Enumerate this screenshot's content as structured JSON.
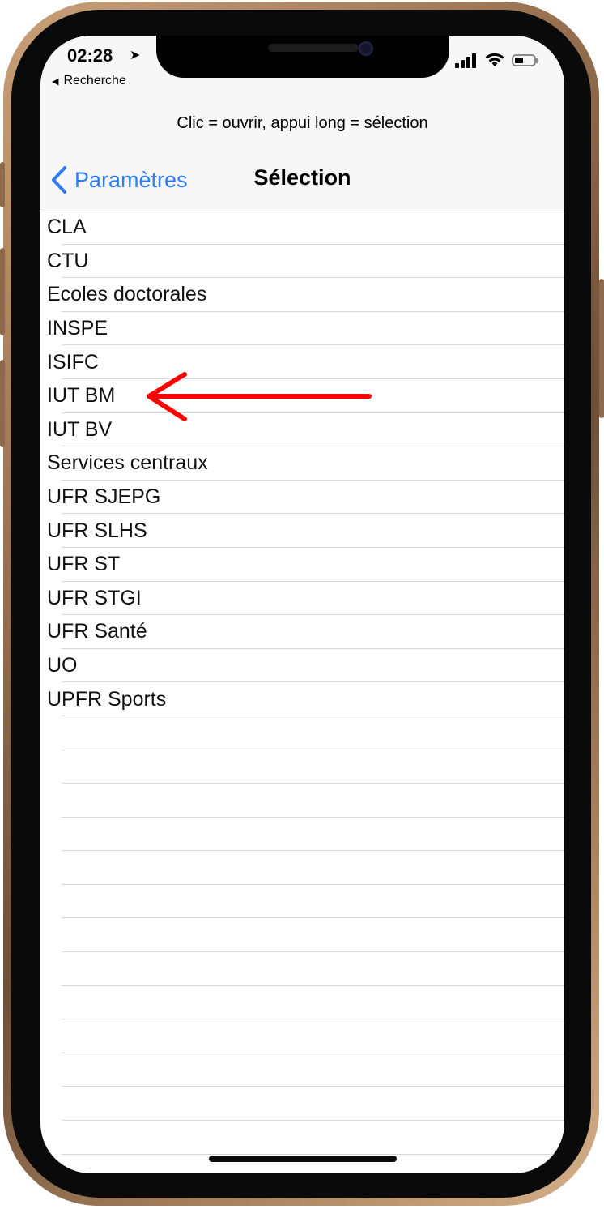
{
  "status_bar": {
    "time": "02:28",
    "back_app_label": "Recherche"
  },
  "hint": "Clic = ouvrir, appui long = sélection",
  "nav": {
    "back_label": "Paramètres",
    "title": "Sélection"
  },
  "list_items": [
    "CLA",
    "CTU",
    "Ecoles doctorales",
    "INSPE",
    "ISIFC",
    "IUT BM",
    "IUT BV",
    "Services centraux",
    "UFR SJEPG",
    "UFR SLHS",
    "UFR ST",
    "UFR STGI",
    "UFR Santé",
    "UO",
    "UPFR Sports"
  ],
  "colors": {
    "accent": "#2f7cf6",
    "annotation_arrow": "#ff0000"
  },
  "annotation": {
    "type": "arrow-icon",
    "points_to_item_index": 5
  }
}
